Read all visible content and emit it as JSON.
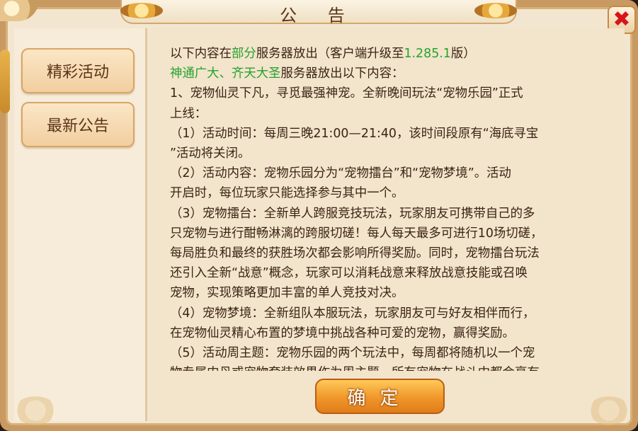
{
  "dialog": {
    "title": "公 告",
    "close_symbol": "✖"
  },
  "sidebar": {
    "items": [
      {
        "label": "精彩活动"
      },
      {
        "label": "最新公告"
      }
    ]
  },
  "content": {
    "line0_pre": "以下内容在",
    "line0_highlight": "部分",
    "line0_post": "服务器放出（客户端升级至",
    "line0_version": "1.285.1",
    "line0_end": "版）",
    "line1_highlight": "神通广大、齐天大圣",
    "line1_post": "服务器放出以下内容：",
    "lines": [
      "1、宠物仙灵下凡，寻觅最强神宠。全新晚间玩法“宠物乐园”正式",
      "上线：",
      "（1）活动时间：每周三晚21:00—21:40，该时间段原有“海底寻宝",
      "”活动将关闭。",
      "（2）活动内容：宠物乐园分为“宠物擂台”和“宠物梦境”。活动",
      "开启时，每位玩家只能选择参与其中一个。",
      "（3）宠物擂台：全新单人跨服竞技玩法，玩家朋友可携带自己的多",
      "只宠物与进行酣畅淋漓的跨服切磋！每人每天最多可进行10场切磋，",
      "每局胜负和最终的获胜场次都会影响所得奖励。同时，宠物擂台玩法",
      "还引入全新“战意”概念，玩家可以消耗战意来释放战意技能或召唤",
      "宠物，实现策略更加丰富的单人竞技对决。",
      "（4）宠物梦境：全新组队本服玩法，玩家朋友可与好友相伴而行，",
      "在宠物仙灵精心布置的梦境中挑战各种可爱的宠物，赢得奖励。",
      "（5）活动周主题：宠物乐园的两个玩法中，每周都将随机以一个宠",
      "物专属内丹或宠物套装效果作为周主题，所有宠物在战斗中都会享有"
    ]
  },
  "buttons": {
    "confirm_label": "确定"
  }
}
